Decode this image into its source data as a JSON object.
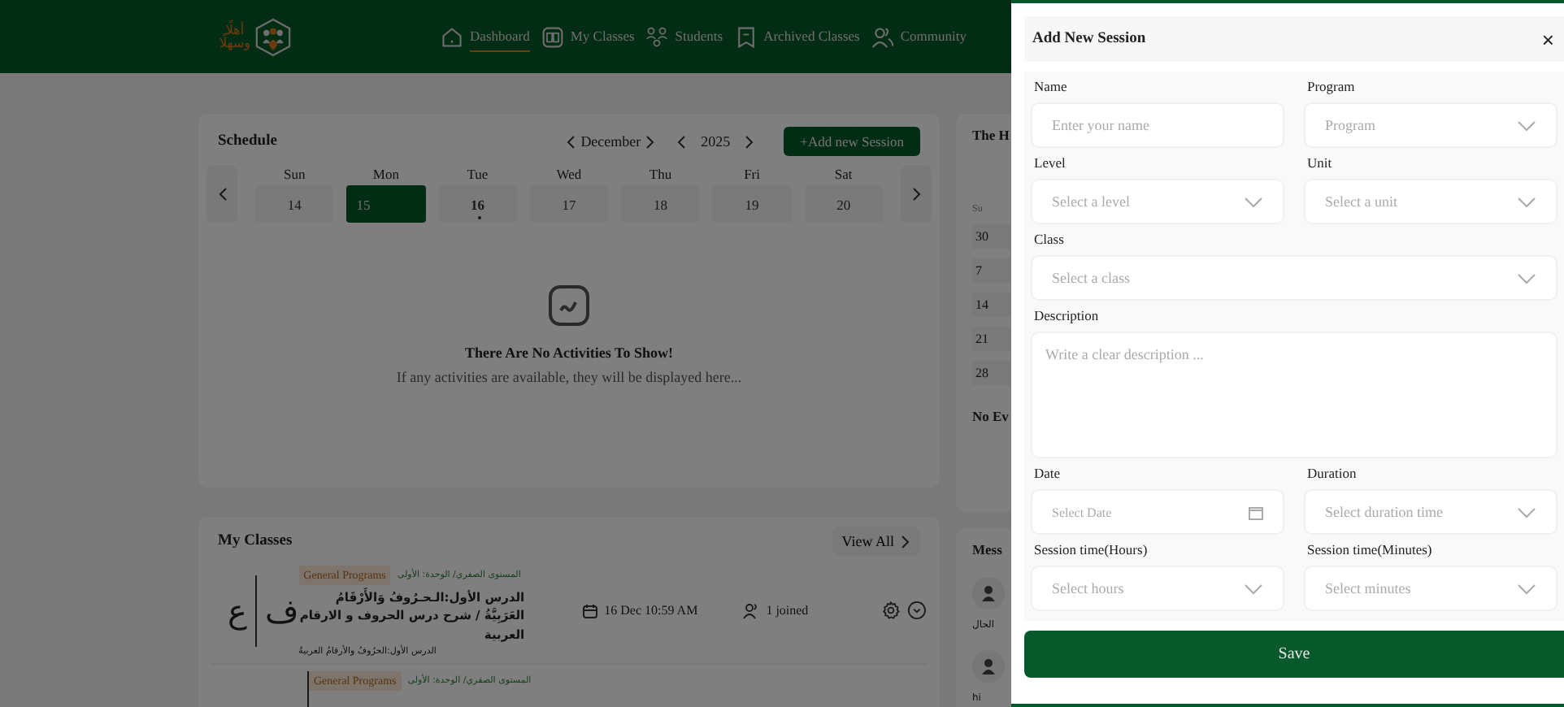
{
  "header": {
    "logo_lines": [
      "أهلًا",
      "وسهلًا"
    ],
    "nav": [
      {
        "label": "Dashboard",
        "selected": true
      },
      {
        "label": "My Classes",
        "selected": false
      },
      {
        "label": "Students",
        "selected": false
      },
      {
        "label": "Archived Classes",
        "selected": false
      },
      {
        "label": "Community",
        "selected": false
      }
    ]
  },
  "schedule": {
    "title": "Schedule",
    "month": "December",
    "year": "2025",
    "add_button": "+Add new Session",
    "days": [
      {
        "weekday": "Sun",
        "date": "14",
        "selected": false,
        "today": false
      },
      {
        "weekday": "Mon",
        "date": "15",
        "selected": true,
        "today": false
      },
      {
        "weekday": "Tue",
        "date": "16",
        "selected": false,
        "today": true
      },
      {
        "weekday": "Wed",
        "date": "17",
        "selected": false,
        "today": false
      },
      {
        "weekday": "Thu",
        "date": "18",
        "selected": false,
        "today": false
      },
      {
        "weekday": "Fri",
        "date": "19",
        "selected": false,
        "today": false
      },
      {
        "weekday": "Sat",
        "date": "20",
        "selected": false,
        "today": false
      }
    ],
    "empty_title": "There Are No Activities To Show!",
    "empty_text": "If any activities are available, they will be displayed here..."
  },
  "my_classes": {
    "title": "My Classes",
    "view_all": "View All",
    "items": [
      {
        "letters": [
          "ف",
          "ع"
        ],
        "tag": "General Programs",
        "meta": "المستوى الصفري/ الوحدة: الأولى",
        "title": "الدرس الأول:الـحـرُوفُ وَالأَرْقَامُ العَرَبِيَّةُ / شرح درس الحروف و الارقام العربية",
        "subtitle": "الدرس الأول:الحرُوفُ والأرقامُ العربيةُ",
        "date": "16 Dec 10:59 AM",
        "joined": "1 joined"
      },
      {
        "tag": "General Programs",
        "meta": "المستوى الصفري/ الوحدة: الأولى"
      }
    ]
  },
  "side_calendar": {
    "title": "The H",
    "weekday": "Su",
    "dates": [
      "30",
      "7",
      "14",
      "21",
      "28"
    ],
    "empty": "No Ev"
  },
  "messages": {
    "title": "Mess",
    "items": [
      {
        "text": "الحال"
      },
      {
        "text": "hi"
      }
    ]
  },
  "drawer": {
    "title": "Add New Session",
    "close": "×",
    "rows": [
      [
        {
          "label": "Name",
          "placeholder": "Enter your name",
          "kind": "text"
        },
        {
          "label": "Program",
          "placeholder": "Program",
          "kind": "select"
        }
      ],
      [
        {
          "label": "Level",
          "placeholder": "Select a level",
          "kind": "select"
        },
        {
          "label": "Unit",
          "placeholder": "Select a unit",
          "kind": "select"
        }
      ],
      [
        {
          "label": "Class",
          "placeholder": "Select a class",
          "kind": "select"
        }
      ],
      [
        {
          "label": "Description",
          "placeholder": "Write a clear description ...",
          "kind": "textarea"
        }
      ],
      [
        {
          "label": "Date",
          "placeholder": "Select Date",
          "kind": "date"
        },
        {
          "label": "Duration",
          "placeholder": "Select duration time",
          "kind": "select"
        }
      ],
      [
        {
          "label": "Session time(Hours)",
          "placeholder": "Select hours",
          "kind": "select"
        },
        {
          "label": "Session time(Minutes)",
          "placeholder": "Select minutes",
          "kind": "select"
        }
      ]
    ],
    "save": "Save"
  }
}
